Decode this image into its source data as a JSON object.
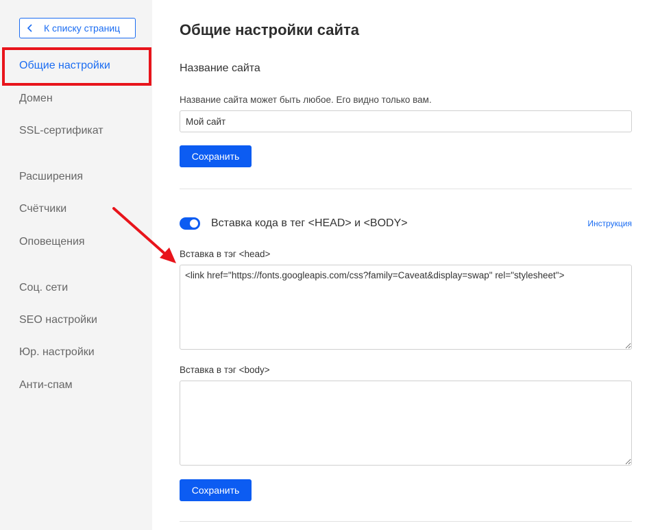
{
  "sidebar": {
    "back_label": "К списку страниц",
    "items": [
      {
        "label": "Общие настройки",
        "active": true
      },
      {
        "label": "Домен"
      },
      {
        "label": "SSL-сертификат"
      },
      {
        "label": "Расширения"
      },
      {
        "label": "Счётчики"
      },
      {
        "label": "Оповещения"
      },
      {
        "label": "Соц. сети"
      },
      {
        "label": "SEO настройки"
      },
      {
        "label": "Юр. настройки"
      },
      {
        "label": "Анти-спам"
      }
    ]
  },
  "main": {
    "title": "Общие настройки сайта",
    "site_name": {
      "section_title": "Название сайта",
      "hint": "Название сайта может быть любое. Его видно только вам.",
      "value": "Мой сайт",
      "save_label": "Сохранить"
    },
    "code_insert": {
      "toggle_on": true,
      "label": "Вставка кода в тег <HEAD> и <BODY>",
      "instruction_link": "Инструкция",
      "head_label": "Вставка в тэг <head>",
      "head_value": "<link href=\"https://fonts.googleapis.com/css?family=Caveat&display=swap\" rel=\"stylesheet\">",
      "body_label": "Вставка в тэг <body>",
      "body_value": "",
      "save_label": "Сохранить"
    }
  },
  "colors": {
    "accent": "#0c5cf2",
    "link": "#1a6cf2",
    "highlight": "#e8141b",
    "sidebar_bg": "#f4f4f4"
  }
}
